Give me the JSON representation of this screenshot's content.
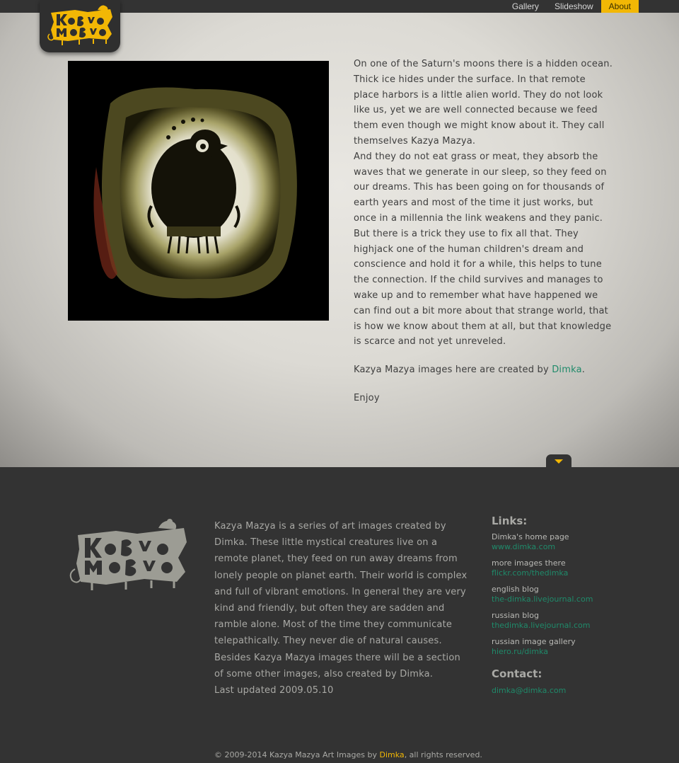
{
  "nav": {
    "items": [
      {
        "label": "Gallery",
        "active": false
      },
      {
        "label": "Slideshow",
        "active": false
      },
      {
        "label": "About",
        "active": true
      }
    ]
  },
  "logo": {
    "text": "Kazya Mazya",
    "color": "#f2b705"
  },
  "about": {
    "paragraph1": "On one of the Saturn's moons there is a hidden ocean. Thick ice hides under the surface. In that remote place harbors is a little alien world. They do not look like us, yet we are well connected because we feed them even though we might know about it. They call themselves Kazya Mazya.",
    "paragraph2": "And they do not eat grass or meat, they absorb the waves that we generate in our sleep, so they feed on our dreams. This has been going on for thousands of earth years and most of the time it just works, but once in a millennia the link weakens and they panic. But there is a trick they use to fix all that. They highjack one of the human children's dream and conscience and hold it for a while, this helps to tune the connection. If the child survives and manages to wake up and to remember what have happened we can find out a bit more about that strange world, that is how we know about them at all, but that knowledge is scarce and not yet unreveled.",
    "credit_prefix": "Kazya Mazya images here are created by ",
    "credit_link": "Dimka",
    "credit_suffix": ".",
    "enjoy": "Enjoy"
  },
  "footer": {
    "description": [
      "Kazya Mazya is a series of art images created by Dimka. These little mystical creatures live on a remote planet, they feed on run away dreams from lonely people on planet earth. Their world is complex and full of vibrant emotions. In general they are very kind and friendly, but often they are sadden and ramble alone. Most of the time they communicate telepathically. They never die of natural causes.",
      "Besides Kazya Mazya images there will be a section of some other images, also created by Dimka.",
      "Last updated 2009.05.10"
    ],
    "links_heading": "Links:",
    "links": [
      {
        "title": "Dimka's home page",
        "url": "www.dimka.com"
      },
      {
        "title": "more images there",
        "url": "flickr.com/thedimka"
      },
      {
        "title": "english blog",
        "url": "the-dimka.livejournal.com"
      },
      {
        "title": "russian blog",
        "url": "thedimka.livejournal.com"
      },
      {
        "title": "russian image gallery",
        "url": "hiero.ru/dimka"
      }
    ],
    "contact_heading": "Contact:",
    "contact_email": "dimka@dimka.com",
    "copyright_prefix": "© 2009-2014 Kazya Mazya Art Images by ",
    "copyright_link": "Dimka",
    "copyright_suffix": ", all rights reserved."
  },
  "colors": {
    "accent": "#f2b705",
    "link": "#1f8a6a",
    "dark": "#333333"
  }
}
